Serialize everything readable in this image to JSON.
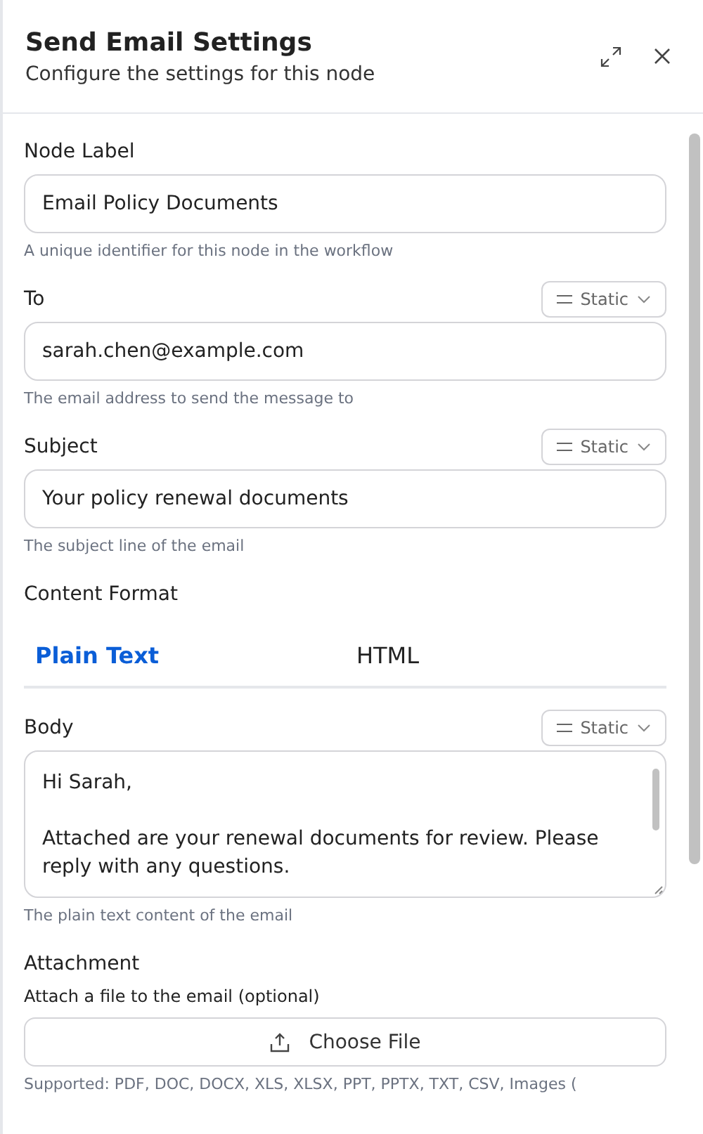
{
  "header": {
    "title": "Send Email Settings",
    "subtitle": "Configure the settings for this node"
  },
  "fields": [
    {
      "kind": "input",
      "label": "Node Label",
      "value": "Email Policy Documents",
      "hint": "A unique identifier for this node in the workflow"
    },
    {
      "kind": "input",
      "label": "To",
      "mode": "Static",
      "value": "sarah.chen@example.com",
      "hint": "The email address to send the message to"
    },
    {
      "kind": "input",
      "label": "Subject",
      "mode": "Static",
      "value": "Your policy renewal documents",
      "hint": "The subject line of the email"
    },
    {
      "kind": "tabs",
      "label": "Content Format",
      "tabs": [
        {
          "label": "Plain Text",
          "selected": true
        },
        {
          "label": "HTML",
          "selected": false
        }
      ]
    },
    {
      "kind": "textarea",
      "label": "Body",
      "mode": "Static",
      "value": "Hi Sarah,\n\nAttached are your renewal documents for review. Please reply with any questions.",
      "hint": "The plain text content of the email"
    },
    {
      "kind": "file",
      "label": "Attachment",
      "description": "Attach a file to the email (optional)",
      "button": "Choose File",
      "hint": "Supported: PDF, DOC, DOCX, XLS, XLSX, PPT, PPTX, TXT, CSV, Images ("
    }
  ]
}
